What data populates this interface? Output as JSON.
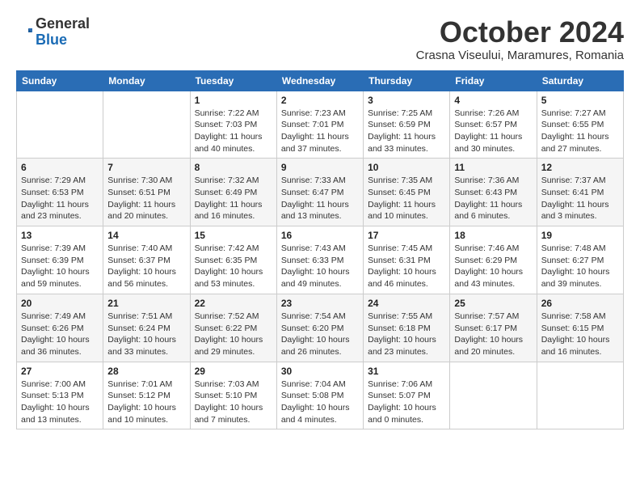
{
  "logo": {
    "general": "General",
    "blue": "Blue"
  },
  "header": {
    "month": "October 2024",
    "location": "Crasna Viseului, Maramures, Romania"
  },
  "weekdays": [
    "Sunday",
    "Monday",
    "Tuesday",
    "Wednesday",
    "Thursday",
    "Friday",
    "Saturday"
  ],
  "weeks": [
    [
      {
        "day": "",
        "detail": ""
      },
      {
        "day": "",
        "detail": ""
      },
      {
        "day": "1",
        "detail": "Sunrise: 7:22 AM\nSunset: 7:03 PM\nDaylight: 11 hours and 40 minutes."
      },
      {
        "day": "2",
        "detail": "Sunrise: 7:23 AM\nSunset: 7:01 PM\nDaylight: 11 hours and 37 minutes."
      },
      {
        "day": "3",
        "detail": "Sunrise: 7:25 AM\nSunset: 6:59 PM\nDaylight: 11 hours and 33 minutes."
      },
      {
        "day": "4",
        "detail": "Sunrise: 7:26 AM\nSunset: 6:57 PM\nDaylight: 11 hours and 30 minutes."
      },
      {
        "day": "5",
        "detail": "Sunrise: 7:27 AM\nSunset: 6:55 PM\nDaylight: 11 hours and 27 minutes."
      }
    ],
    [
      {
        "day": "6",
        "detail": "Sunrise: 7:29 AM\nSunset: 6:53 PM\nDaylight: 11 hours and 23 minutes."
      },
      {
        "day": "7",
        "detail": "Sunrise: 7:30 AM\nSunset: 6:51 PM\nDaylight: 11 hours and 20 minutes."
      },
      {
        "day": "8",
        "detail": "Sunrise: 7:32 AM\nSunset: 6:49 PM\nDaylight: 11 hours and 16 minutes."
      },
      {
        "day": "9",
        "detail": "Sunrise: 7:33 AM\nSunset: 6:47 PM\nDaylight: 11 hours and 13 minutes."
      },
      {
        "day": "10",
        "detail": "Sunrise: 7:35 AM\nSunset: 6:45 PM\nDaylight: 11 hours and 10 minutes."
      },
      {
        "day": "11",
        "detail": "Sunrise: 7:36 AM\nSunset: 6:43 PM\nDaylight: 11 hours and 6 minutes."
      },
      {
        "day": "12",
        "detail": "Sunrise: 7:37 AM\nSunset: 6:41 PM\nDaylight: 11 hours and 3 minutes."
      }
    ],
    [
      {
        "day": "13",
        "detail": "Sunrise: 7:39 AM\nSunset: 6:39 PM\nDaylight: 10 hours and 59 minutes."
      },
      {
        "day": "14",
        "detail": "Sunrise: 7:40 AM\nSunset: 6:37 PM\nDaylight: 10 hours and 56 minutes."
      },
      {
        "day": "15",
        "detail": "Sunrise: 7:42 AM\nSunset: 6:35 PM\nDaylight: 10 hours and 53 minutes."
      },
      {
        "day": "16",
        "detail": "Sunrise: 7:43 AM\nSunset: 6:33 PM\nDaylight: 10 hours and 49 minutes."
      },
      {
        "day": "17",
        "detail": "Sunrise: 7:45 AM\nSunset: 6:31 PM\nDaylight: 10 hours and 46 minutes."
      },
      {
        "day": "18",
        "detail": "Sunrise: 7:46 AM\nSunset: 6:29 PM\nDaylight: 10 hours and 43 minutes."
      },
      {
        "day": "19",
        "detail": "Sunrise: 7:48 AM\nSunset: 6:27 PM\nDaylight: 10 hours and 39 minutes."
      }
    ],
    [
      {
        "day": "20",
        "detail": "Sunrise: 7:49 AM\nSunset: 6:26 PM\nDaylight: 10 hours and 36 minutes."
      },
      {
        "day": "21",
        "detail": "Sunrise: 7:51 AM\nSunset: 6:24 PM\nDaylight: 10 hours and 33 minutes."
      },
      {
        "day": "22",
        "detail": "Sunrise: 7:52 AM\nSunset: 6:22 PM\nDaylight: 10 hours and 29 minutes."
      },
      {
        "day": "23",
        "detail": "Sunrise: 7:54 AM\nSunset: 6:20 PM\nDaylight: 10 hours and 26 minutes."
      },
      {
        "day": "24",
        "detail": "Sunrise: 7:55 AM\nSunset: 6:18 PM\nDaylight: 10 hours and 23 minutes."
      },
      {
        "day": "25",
        "detail": "Sunrise: 7:57 AM\nSunset: 6:17 PM\nDaylight: 10 hours and 20 minutes."
      },
      {
        "day": "26",
        "detail": "Sunrise: 7:58 AM\nSunset: 6:15 PM\nDaylight: 10 hours and 16 minutes."
      }
    ],
    [
      {
        "day": "27",
        "detail": "Sunrise: 7:00 AM\nSunset: 5:13 PM\nDaylight: 10 hours and 13 minutes."
      },
      {
        "day": "28",
        "detail": "Sunrise: 7:01 AM\nSunset: 5:12 PM\nDaylight: 10 hours and 10 minutes."
      },
      {
        "day": "29",
        "detail": "Sunrise: 7:03 AM\nSunset: 5:10 PM\nDaylight: 10 hours and 7 minutes."
      },
      {
        "day": "30",
        "detail": "Sunrise: 7:04 AM\nSunset: 5:08 PM\nDaylight: 10 hours and 4 minutes."
      },
      {
        "day": "31",
        "detail": "Sunrise: 7:06 AM\nSunset: 5:07 PM\nDaylight: 10 hours and 0 minutes."
      },
      {
        "day": "",
        "detail": ""
      },
      {
        "day": "",
        "detail": ""
      }
    ]
  ]
}
